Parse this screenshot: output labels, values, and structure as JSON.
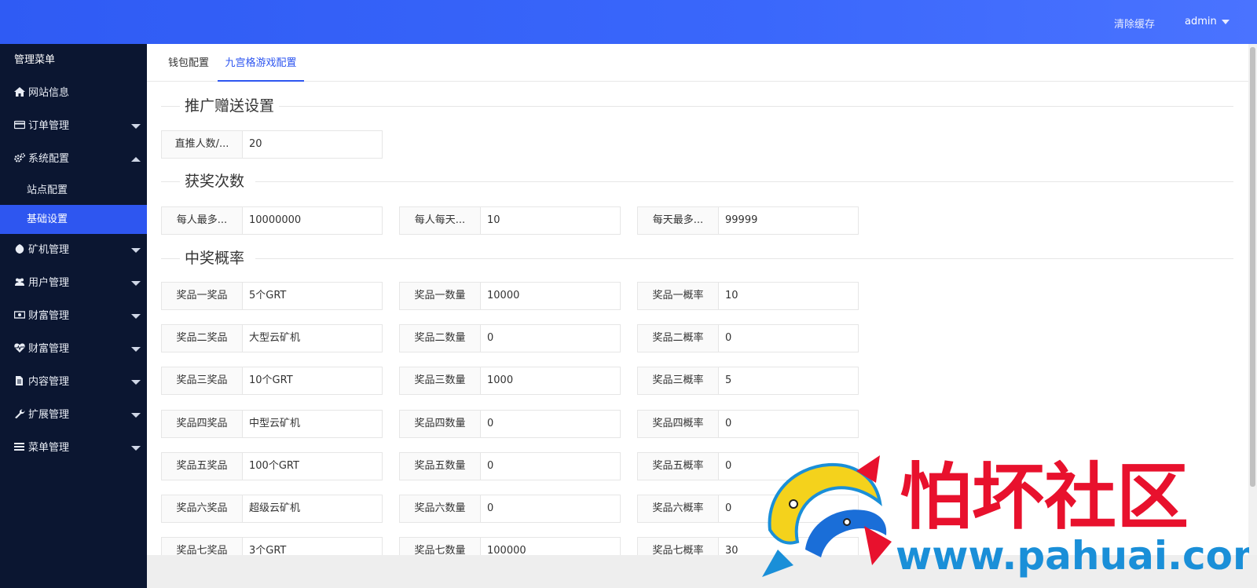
{
  "topbar": {
    "clear_cache": "清除缓存",
    "user": "admin"
  },
  "sidebar": {
    "title": "管理菜单",
    "items": [
      {
        "label": "网站信息",
        "icon": "home-icon"
      },
      {
        "label": "订单管理",
        "icon": "credit-card-icon"
      },
      {
        "label": "系统配置",
        "icon": "gears-icon",
        "sub": [
          {
            "label": "站点配置"
          },
          {
            "label": "基础设置",
            "active": true
          }
        ]
      },
      {
        "label": "矿机管理",
        "icon": "rebel-icon"
      },
      {
        "label": "用户管理",
        "icon": "users-icon"
      },
      {
        "label": "财富管理",
        "icon": "money-icon"
      },
      {
        "label": "财富管理",
        "icon": "heartbeat-icon"
      },
      {
        "label": "内容管理",
        "icon": "file-icon"
      },
      {
        "label": "扩展管理",
        "icon": "wrench-icon"
      },
      {
        "label": "菜单管理",
        "icon": "bars-icon"
      }
    ]
  },
  "tabs": [
    {
      "label": "钱包配置"
    },
    {
      "label": "九宫格游戏配置",
      "active": true
    }
  ],
  "sections": {
    "promo": {
      "title": "推广赠送设置",
      "fields": [
        {
          "label": "直推人数/...",
          "value": "20"
        }
      ]
    },
    "wins": {
      "title": "获奖次数",
      "fields": [
        {
          "label": "每人最多...",
          "value": "10000000"
        },
        {
          "label": "每人每天...",
          "value": "10"
        },
        {
          "label": "每天最多...",
          "value": "99999"
        }
      ]
    },
    "prob": {
      "title": "中奖概率",
      "rows": [
        [
          {
            "label": "奖品一奖品",
            "value": "5个GRT"
          },
          {
            "label": "奖品一数量",
            "value": "10000"
          },
          {
            "label": "奖品一概率",
            "value": "10"
          }
        ],
        [
          {
            "label": "奖品二奖品",
            "value": "大型云矿机"
          },
          {
            "label": "奖品二数量",
            "value": "0"
          },
          {
            "label": "奖品二概率",
            "value": "0"
          }
        ],
        [
          {
            "label": "奖品三奖品",
            "value": "10个GRT"
          },
          {
            "label": "奖品三数量",
            "value": "1000"
          },
          {
            "label": "奖品三概率",
            "value": "5"
          }
        ],
        [
          {
            "label": "奖品四奖品",
            "value": "中型云矿机"
          },
          {
            "label": "奖品四数量",
            "value": "0"
          },
          {
            "label": "奖品四概率",
            "value": "0"
          }
        ],
        [
          {
            "label": "奖品五奖品",
            "value": "100个GRT"
          },
          {
            "label": "奖品五数量",
            "value": "0"
          },
          {
            "label": "奖品五概率",
            "value": "0"
          }
        ],
        [
          {
            "label": "奖品六奖品",
            "value": "超级云矿机"
          },
          {
            "label": "奖品六数量",
            "value": "0"
          },
          {
            "label": "奖品六概率",
            "value": "0"
          }
        ],
        [
          {
            "label": "奖品七奖品",
            "value": "3个GRT"
          },
          {
            "label": "奖品七数量",
            "value": "100000"
          },
          {
            "label": "奖品七概率",
            "value": "30"
          }
        ]
      ]
    }
  },
  "watermark": {
    "name": "怕坏社区",
    "url": "www.pahuai.com"
  },
  "colors": {
    "accent": "#2e56f0",
    "sidebar_bg": "#0b1631",
    "watermark_red": "#e8112d",
    "watermark_blue": "#1a8fd8"
  }
}
